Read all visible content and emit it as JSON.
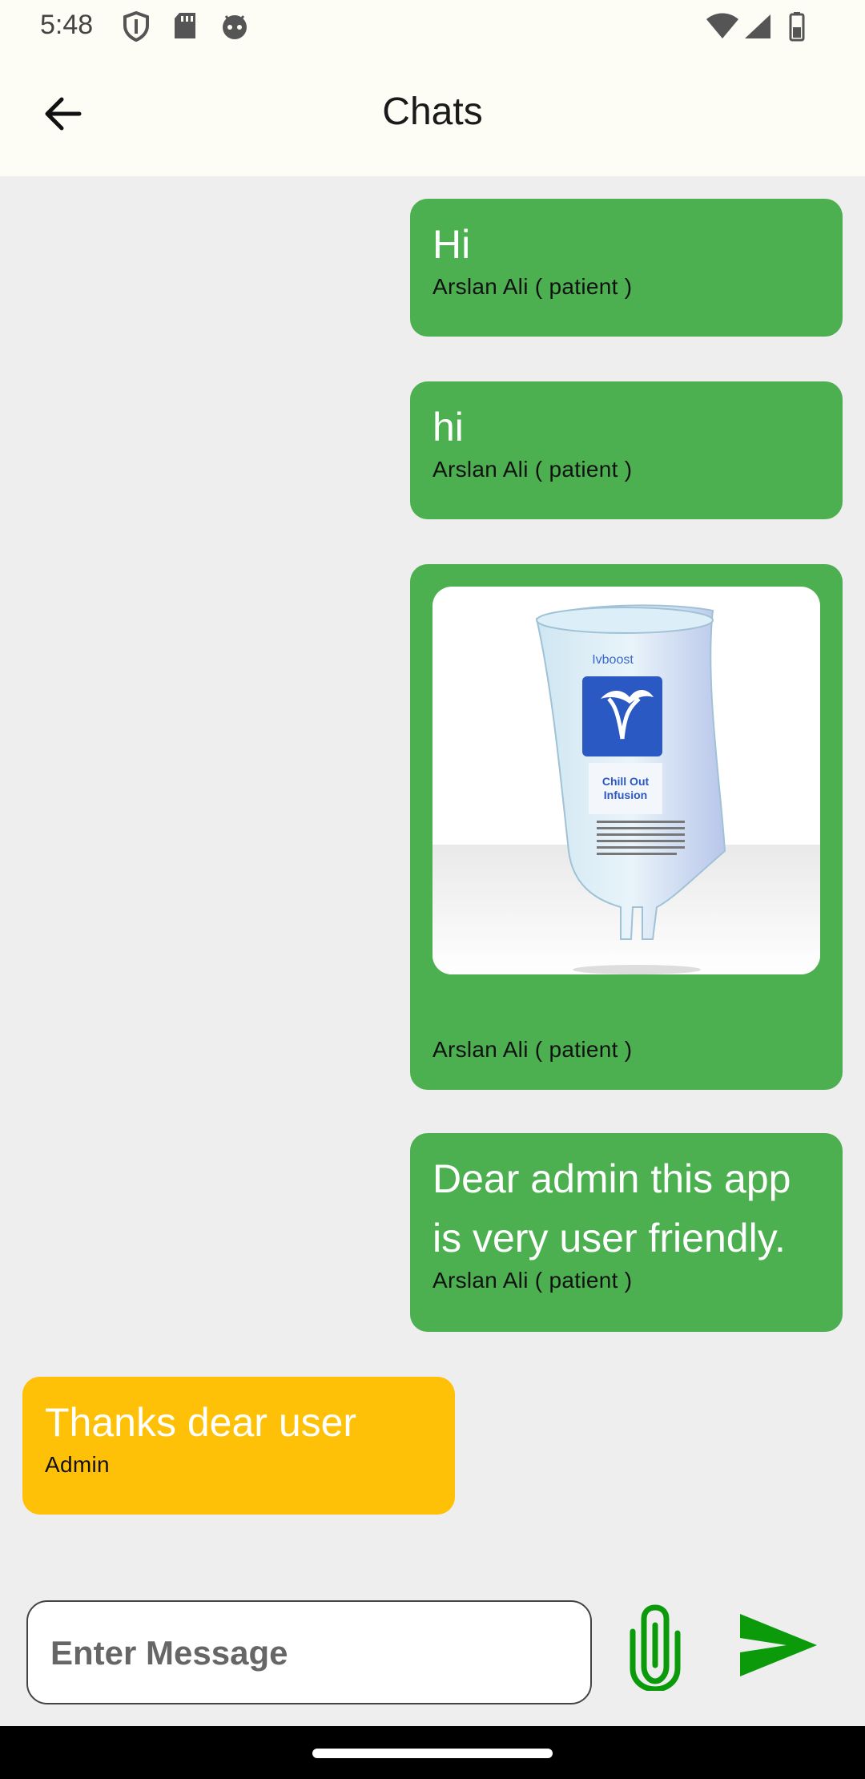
{
  "status_bar": {
    "time": "5:48",
    "icons": [
      "shield-icon",
      "sd-card-icon",
      "android-face-icon",
      "wifi-icon",
      "signal-icon",
      "battery-icon"
    ]
  },
  "app_bar": {
    "title": "Chats",
    "back_icon": "arrow-back-icon"
  },
  "messages": [
    {
      "text": "Hi",
      "sender": "Arslan Ali ( patient )",
      "color": "#4CAF50"
    },
    {
      "text": "hi",
      "sender": "Arslan Ali ( patient )",
      "color": "#4CAF50"
    },
    {
      "image_label": "Ivboost",
      "image_caption_1": "Chill Out",
      "image_caption_2": "Infusion",
      "sender": "Arslan Ali ( patient )",
      "color": "#4CAF50"
    },
    {
      "text_line_1": "Dear admin this app",
      "text_line_2": "is very user friendly.",
      "sender": "Arslan Ali ( patient )",
      "color": "#4CAF50"
    },
    {
      "text": "Thanks dear user",
      "sender": "Admin",
      "color": "#FFC107"
    }
  ],
  "composer": {
    "placeholder": "Enter Message",
    "attach_icon": "paperclip-icon",
    "send_icon": "send-icon",
    "accent": "#0A9A0A"
  }
}
